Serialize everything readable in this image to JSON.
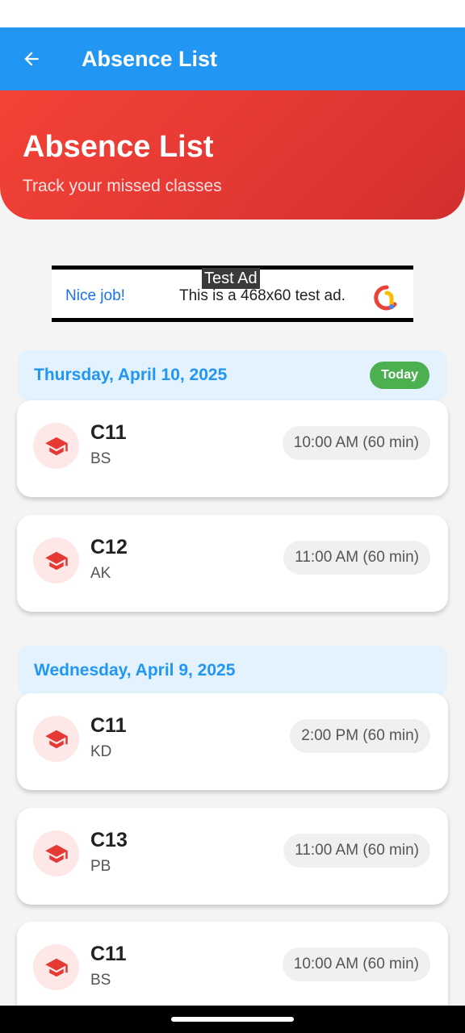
{
  "app_bar": {
    "title": "Absence List",
    "back_icon": "arrow-left-icon"
  },
  "hero": {
    "title": "Absence List",
    "subtitle": "Track your missed classes"
  },
  "ad": {
    "tag": "Test Ad",
    "nice": "Nice job!",
    "text": "This is a 468x60 test ad."
  },
  "colors": {
    "primary": "#2196f3",
    "hero_red": "#e53935",
    "badge_green": "#4caf50",
    "icon_red": "#e53935"
  },
  "groups": [
    {
      "date": "Thursday, April 10, 2025",
      "badge": "Today",
      "items": [
        {
          "title": "C11",
          "subtitle": "BS",
          "time": "10:00 AM (60 min)",
          "icon": "graduation-cap-icon"
        },
        {
          "title": "C12",
          "subtitle": "AK",
          "time": "11:00 AM (60 min)",
          "icon": "graduation-cap-icon"
        }
      ]
    },
    {
      "date": "Wednesday, April 9, 2025",
      "items": [
        {
          "title": "C11",
          "subtitle": "KD",
          "time": "2:00 PM (60 min)",
          "icon": "graduation-cap-icon"
        },
        {
          "title": "C13",
          "subtitle": "PB",
          "time": "11:00 AM (60 min)",
          "icon": "graduation-cap-icon"
        },
        {
          "title": "C11",
          "subtitle": "BS",
          "time": "10:00 AM (60 min)",
          "icon": "graduation-cap-icon"
        }
      ]
    }
  ]
}
